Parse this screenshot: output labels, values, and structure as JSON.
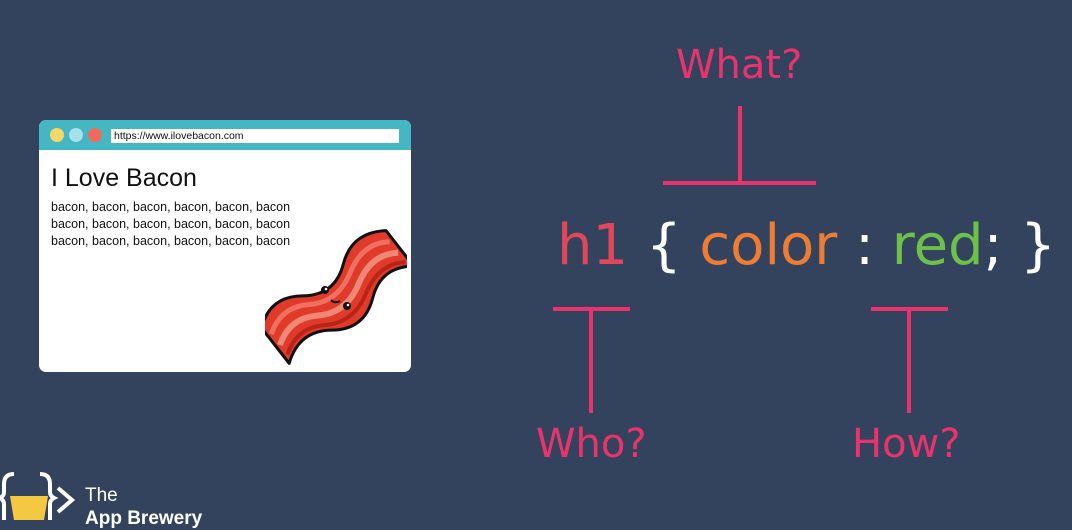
{
  "browser": {
    "url": "https://www.ilovebacon.com",
    "page_title": "I Love Bacon",
    "lines": [
      "bacon, bacon, bacon, bacon, bacon, bacon",
      "bacon, bacon, bacon, bacon, bacon, bacon",
      "bacon, bacon, bacon, bacon, bacon, bacon"
    ],
    "dot_colors": [
      "#f7d767",
      "#a6e0ea",
      "#f06a5a"
    ],
    "bar_color": "#44b7c3"
  },
  "diagram": {
    "what_label": "What?",
    "who_label": "Who?",
    "how_label": "How?",
    "selector": "h1",
    "open_brace": "{",
    "property": "color",
    "colon": ":",
    "value": "red",
    "semicolon": ";",
    "close_brace": "}",
    "colors": {
      "labels": "#e8336c",
      "selector": "#e0485a",
      "property": "#ee7d33",
      "value": "#6dc04a",
      "punctuation": "#ffffff"
    }
  },
  "logo": {
    "line1": "The",
    "line2": "App Brewery"
  },
  "background": "#33435e"
}
